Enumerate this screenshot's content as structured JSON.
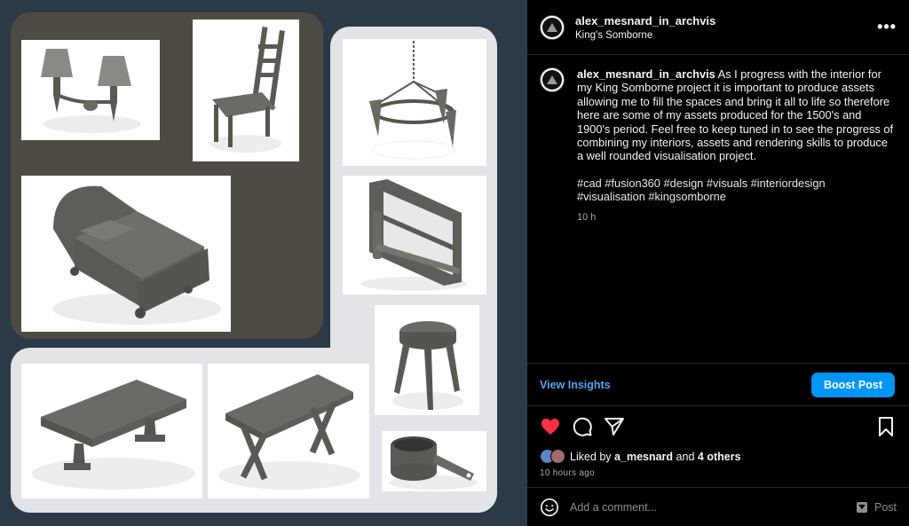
{
  "post": {
    "username": "alex_mesnard_in_archvis",
    "location": "King's Somborne",
    "more_label": "•••",
    "caption_text": "As I progress with the interior for my King Somborne project it is important to produce assets allowing me to fill the spaces and bring it all to life so therefore here are some of my assets produced for the 1500's and 1900's period. Feel free to keep tuned in to see the progress of combining my interiors, assets and rendering skills to produce a well rounded visualisation project.",
    "hashtags": "#cad #fusion360 #design #visuals #interiordesign #visualisation #kingsomborne",
    "age": "10 h"
  },
  "insights": {
    "view_label": "View Insights",
    "boost_label": "Boost Post"
  },
  "actions": {
    "like_icon": "heart-icon",
    "comment_icon": "comment-icon",
    "share_icon": "send-icon",
    "save_icon": "bookmark-icon",
    "liked": true,
    "like_color": "#ff3040"
  },
  "likes": {
    "prefix": "Liked by",
    "user": "a_mesnard",
    "and": "and",
    "others": "4 others",
    "time": "10 hours ago"
  },
  "comment": {
    "placeholder": "Add a comment...",
    "post_label": "Post"
  },
  "image": {
    "items": [
      "wall-sconce",
      "chair",
      "chandelier",
      "bed",
      "shelf",
      "stool",
      "refectory-table",
      "trestle-table",
      "saucepan"
    ],
    "colors": {
      "background": "#2c3a48",
      "dark_panel": "#4d4b44",
      "light_panel": "#e2e4e7",
      "model": "#5a5a55"
    }
  }
}
